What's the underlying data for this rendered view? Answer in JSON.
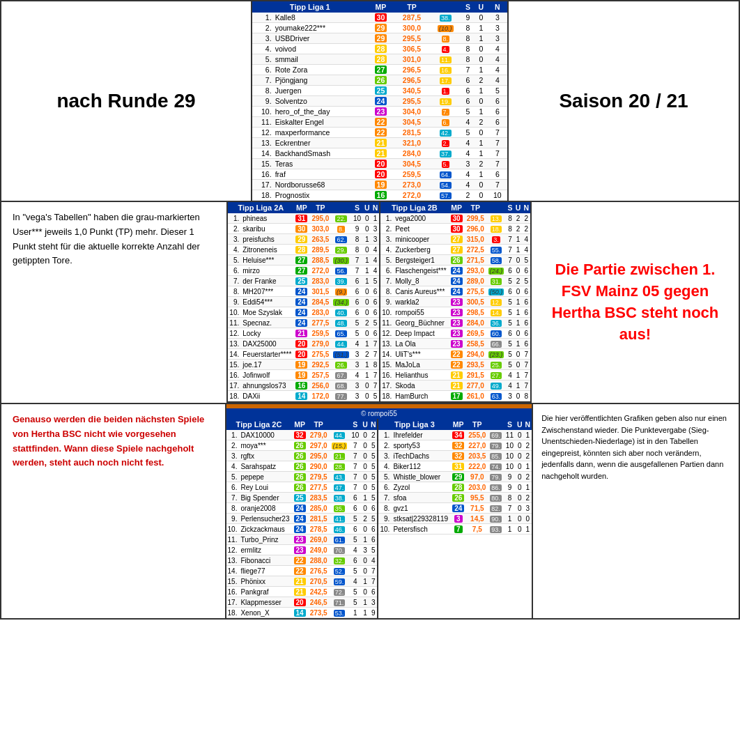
{
  "header": {
    "left_title": "nach Runde 29",
    "right_title": "Saison 20 / 21"
  },
  "mid_left_text": "In \"vega's Tabellen\" haben die grau-markierten User*** jeweils 1,0 Punkt (TP) mehr. Dieser 1 Punkt steht für die aktuelle korrekte Anzahl der getippten Tore.",
  "mid_right_text": "Die Partie zwischen 1. FSV Mainz 05 gegen Hertha BSC steht noch aus!",
  "bot_left_text": "Genauso werden die beiden nächsten Spiele von Hertha BSC nicht wie vorgesehen stattfinden. Wann diese Spiele nachgeholt werden, steht auch noch nicht fest.",
  "bot_right_text": "Die hier veröffentlichten Grafiken geben also nur einen Zwischenstand wieder. Die Punktevergabe (Sieg-Unentschieden-Niederlage) ist in den Tabellen eingepreist, könnten sich aber noch verändern, jedenfalls dann, wenn die ausgefallenen Partien dann nachgeholt wurden.",
  "rompoi_label": "© rompoi55",
  "liga1": {
    "title": "Tipp Liga 1",
    "cols": [
      "MP",
      "TP",
      "",
      "S",
      "U",
      "N"
    ],
    "rows": [
      {
        "rank": "1.",
        "name": "Kalle8",
        "mp": "30",
        "tp": "287,5",
        "badge": "38.",
        "s": "9",
        "u": "0",
        "n": "3",
        "mp_color": "red"
      },
      {
        "rank": "2.",
        "name": "youmake222***",
        "mp": "29",
        "tp": "300,0",
        "badge": "(10.)",
        "s": "8",
        "u": "1",
        "n": "3",
        "mp_color": "orange",
        "hl": "gray"
      },
      {
        "rank": "3.",
        "name": "USBDriver",
        "mp": "29",
        "tp": "295,5",
        "badge": "8.",
        "s": "8",
        "u": "1",
        "n": "3",
        "mp_color": "orange"
      },
      {
        "rank": "4.",
        "name": "voivod",
        "mp": "28",
        "tp": "306,5",
        "badge": "4.",
        "s": "8",
        "u": "0",
        "n": "4",
        "mp_color": "yellow"
      },
      {
        "rank": "5.",
        "name": "smmail",
        "mp": "28",
        "tp": "301,0",
        "badge": "11.",
        "s": "8",
        "u": "0",
        "n": "4",
        "mp_color": "yellow"
      },
      {
        "rank": "6.",
        "name": "Rote Zora",
        "mp": "27",
        "tp": "296,5",
        "badge": "16.",
        "s": "7",
        "u": "1",
        "n": "4",
        "mp_color": "green"
      },
      {
        "rank": "7.",
        "name": "Pjöngjang",
        "mp": "26",
        "tp": "296,5",
        "badge": "17.",
        "s": "6",
        "u": "2",
        "n": "4",
        "mp_color": "lime"
      },
      {
        "rank": "8.",
        "name": "Juergen",
        "mp": "25",
        "tp": "340,5",
        "badge": "1.",
        "s": "6",
        "u": "1",
        "n": "5",
        "mp_color": "cyan"
      },
      {
        "rank": "9.",
        "name": "Solventzo",
        "mp": "24",
        "tp": "295,5",
        "badge": "19.",
        "s": "6",
        "u": "0",
        "n": "6",
        "mp_color": "blue"
      },
      {
        "rank": "10.",
        "name": "hero_of_the_day",
        "mp": "23",
        "tp": "304,0",
        "badge": "7.",
        "s": "5",
        "u": "1",
        "n": "6",
        "mp_color": "magenta"
      },
      {
        "rank": "11.",
        "name": "Eiskalter Engel",
        "mp": "22",
        "tp": "304,5",
        "badge": "6.",
        "s": "4",
        "u": "2",
        "n": "6",
        "mp_color": "orange"
      },
      {
        "rank": "12.",
        "name": "maxperformance",
        "mp": "22",
        "tp": "281,5",
        "badge": "42.",
        "s": "5",
        "u": "0",
        "n": "7",
        "mp_color": "orange"
      },
      {
        "rank": "13.",
        "name": "Eckrentner",
        "mp": "21",
        "tp": "321,0",
        "badge": "2.",
        "s": "4",
        "u": "1",
        "n": "7",
        "mp_color": "yellow",
        "hl": "gray"
      },
      {
        "rank": "14.",
        "name": "BackhandSmash",
        "mp": "21",
        "tp": "284,0",
        "badge": "37.",
        "s": "4",
        "u": "1",
        "n": "7",
        "mp_color": "yellow"
      },
      {
        "rank": "15.",
        "name": "Teras",
        "mp": "20",
        "tp": "304,5",
        "badge": "5.",
        "s": "3",
        "u": "2",
        "n": "7",
        "mp_color": "red"
      },
      {
        "rank": "16.",
        "name": "fraf",
        "mp": "20",
        "tp": "259,5",
        "badge": "64.",
        "s": "4",
        "u": "1",
        "n": "6",
        "mp_color": "red"
      },
      {
        "rank": "17.",
        "name": "Nordborusse68",
        "mp": "19",
        "tp": "273,0",
        "badge": "54.",
        "s": "4",
        "u": "0",
        "n": "7",
        "mp_color": "orange"
      },
      {
        "rank": "18.",
        "name": "Prognostix",
        "mp": "16",
        "tp": "272,0",
        "badge": "57.",
        "s": "2",
        "u": "0",
        "n": "10",
        "mp_color": "green"
      }
    ]
  },
  "liga2a": {
    "title": "Tipp Liga 2A",
    "cols": [
      "MP",
      "TP",
      "",
      "S",
      "U",
      "N"
    ],
    "rows": [
      {
        "rank": "1.",
        "name": "phineas",
        "mp": "31",
        "tp": "295,0",
        "badge": "22.",
        "s": "10",
        "u": "0",
        "n": "1",
        "mp_color": "red"
      },
      {
        "rank": "2.",
        "name": "skaribu",
        "mp": "30",
        "tp": "303,0",
        "badge": "8.",
        "s": "9",
        "u": "0",
        "n": "3",
        "mp_color": "orange"
      },
      {
        "rank": "3.",
        "name": "preisfuchs",
        "mp": "29",
        "tp": "263,5",
        "badge": "62.",
        "s": "8",
        "u": "1",
        "n": "3",
        "mp_color": "yellow"
      },
      {
        "rank": "4.",
        "name": "Zitroneneis",
        "mp": "28",
        "tp": "289,5",
        "badge": "29.",
        "s": "8",
        "u": "0",
        "n": "4",
        "mp_color": "yellow"
      },
      {
        "rank": "5.",
        "name": "Heluise***",
        "mp": "27",
        "tp": "288,5",
        "badge": "(30.)",
        "s": "7",
        "u": "1",
        "n": "4",
        "mp_color": "green",
        "hl": "gray"
      },
      {
        "rank": "6.",
        "name": "mirzo",
        "mp": "27",
        "tp": "272,0",
        "badge": "56.",
        "s": "7",
        "u": "1",
        "n": "4",
        "mp_color": "green"
      },
      {
        "rank": "7.",
        "name": "der Franke",
        "mp": "25",
        "tp": "283,0",
        "badge": "39.",
        "s": "6",
        "u": "1",
        "n": "5",
        "mp_color": "cyan"
      },
      {
        "rank": "8.",
        "name": "MH207***",
        "mp": "24",
        "tp": "301,5",
        "badge": "(9.)",
        "s": "6",
        "u": "0",
        "n": "6",
        "mp_color": "blue",
        "hl": "gray"
      },
      {
        "rank": "9.",
        "name": "Eddi54***",
        "mp": "24",
        "tp": "284,5",
        "badge": "(34.)",
        "s": "6",
        "u": "0",
        "n": "6",
        "mp_color": "blue",
        "hl": "gray"
      },
      {
        "rank": "10.",
        "name": "Moe Szyslak",
        "mp": "24",
        "tp": "283,0",
        "badge": "40.",
        "s": "6",
        "u": "0",
        "n": "6",
        "mp_color": "blue"
      },
      {
        "rank": "11.",
        "name": "Specnaz.",
        "mp": "24",
        "tp": "277,5",
        "badge": "48.",
        "s": "5",
        "u": "2",
        "n": "5",
        "mp_color": "blue"
      },
      {
        "rank": "12.",
        "name": "Locky",
        "mp": "21",
        "tp": "259,5",
        "badge": "65.",
        "s": "5",
        "u": "0",
        "n": "6",
        "mp_color": "magenta"
      },
      {
        "rank": "13.",
        "name": "DAX25000",
        "mp": "20",
        "tp": "279,0",
        "badge": "44.",
        "s": "4",
        "u": "1",
        "n": "7",
        "mp_color": "red"
      },
      {
        "rank": "14.",
        "name": "Feuerstarter****",
        "mp": "20",
        "tp": "275,5",
        "badge": "(51.)",
        "s": "3",
        "u": "2",
        "n": "7",
        "mp_color": "red",
        "hl": "gray"
      },
      {
        "rank": "15.",
        "name": "joe.17",
        "mp": "19",
        "tp": "292,5",
        "badge": "26.",
        "s": "3",
        "u": "1",
        "n": "8",
        "mp_color": "orange"
      },
      {
        "rank": "16.",
        "name": "Jofinwolf",
        "mp": "19",
        "tp": "257,5",
        "badge": "67.",
        "s": "4",
        "u": "1",
        "n": "7",
        "mp_color": "orange"
      },
      {
        "rank": "17.",
        "name": "ahnungslos73",
        "mp": "16",
        "tp": "256,0",
        "badge": "68.",
        "s": "3",
        "u": "0",
        "n": "7",
        "mp_color": "green"
      },
      {
        "rank": "18.",
        "name": "DAXii",
        "mp": "14",
        "tp": "172,0",
        "badge": "77.",
        "s": "3",
        "u": "0",
        "n": "5",
        "mp_color": "cyan"
      }
    ]
  },
  "liga2b": {
    "title": "Tipp Liga 2B",
    "cols": [
      "MP",
      "TP",
      "",
      "S",
      "U",
      "N"
    ],
    "rows": [
      {
        "rank": "1.",
        "name": "vega2000",
        "mp": "30",
        "tp": "299,5",
        "badge": "13.",
        "s": "8",
        "u": "2",
        "n": "2",
        "mp_color": "red"
      },
      {
        "rank": "2.",
        "name": "Peet",
        "mp": "30",
        "tp": "296,0",
        "badge": "18.",
        "s": "8",
        "u": "2",
        "n": "2",
        "mp_color": "red"
      },
      {
        "rank": "3.",
        "name": "minicooper",
        "mp": "27",
        "tp": "315,0",
        "badge": "3.",
        "s": "7",
        "u": "1",
        "n": "4",
        "mp_color": "yellow"
      },
      {
        "rank": "4.",
        "name": "Zuckerberg",
        "mp": "27",
        "tp": "272,5",
        "badge": "55.",
        "s": "7",
        "u": "1",
        "n": "4",
        "mp_color": "yellow"
      },
      {
        "rank": "5.",
        "name": "Bergsteiger1",
        "mp": "26",
        "tp": "271,5",
        "badge": "58.",
        "s": "7",
        "u": "0",
        "n": "5",
        "mp_color": "lime"
      },
      {
        "rank": "6.",
        "name": "Flaschengeist***",
        "mp": "24",
        "tp": "293,0",
        "badge": "(24.)",
        "s": "6",
        "u": "0",
        "n": "6",
        "mp_color": "blue",
        "hl": "gray"
      },
      {
        "rank": "7.",
        "name": "Molly_8",
        "mp": "24",
        "tp": "289,0",
        "badge": "31.",
        "s": "5",
        "u": "2",
        "n": "5",
        "mp_color": "blue"
      },
      {
        "rank": "8.",
        "name": "Canis Aureus***",
        "mp": "24",
        "tp": "275,5",
        "badge": "(50.)",
        "s": "6",
        "u": "0",
        "n": "6",
        "mp_color": "blue",
        "hl": "gray"
      },
      {
        "rank": "9.",
        "name": "warkla2",
        "mp": "23",
        "tp": "300,5",
        "badge": "12.",
        "s": "5",
        "u": "1",
        "n": "6",
        "mp_color": "magenta"
      },
      {
        "rank": "10.",
        "name": "rompoi55",
        "mp": "23",
        "tp": "298,5",
        "badge": "14.",
        "s": "5",
        "u": "1",
        "n": "6",
        "mp_color": "magenta"
      },
      {
        "rank": "11.",
        "name": "Georg_Büchner",
        "mp": "23",
        "tp": "284,0",
        "badge": "36.",
        "s": "5",
        "u": "1",
        "n": "6",
        "mp_color": "magenta"
      },
      {
        "rank": "12.",
        "name": "Deep Impact",
        "mp": "23",
        "tp": "269,5",
        "badge": "60.",
        "s": "6",
        "u": "0",
        "n": "6",
        "mp_color": "magenta"
      },
      {
        "rank": "13.",
        "name": "La Ola",
        "mp": "23",
        "tp": "258,5",
        "badge": "66.",
        "s": "5",
        "u": "1",
        "n": "6",
        "mp_color": "magenta"
      },
      {
        "rank": "14.",
        "name": "UliT's***",
        "mp": "22",
        "tp": "294,0",
        "badge": "(23.)",
        "s": "5",
        "u": "0",
        "n": "7",
        "mp_color": "orange",
        "hl": "gray"
      },
      {
        "rank": "15.",
        "name": "MaJoLa",
        "mp": "22",
        "tp": "293,5",
        "badge": "25.",
        "s": "5",
        "u": "0",
        "n": "7",
        "mp_color": "orange"
      },
      {
        "rank": "16.",
        "name": "Helianthus",
        "mp": "21",
        "tp": "291,5",
        "badge": "27.",
        "s": "4",
        "u": "1",
        "n": "7",
        "mp_color": "yellow"
      },
      {
        "rank": "17.",
        "name": "Skoda",
        "mp": "21",
        "tp": "277,0",
        "badge": "49.",
        "s": "4",
        "u": "1",
        "n": "7",
        "mp_color": "yellow"
      },
      {
        "rank": "18.",
        "name": "HamBurch",
        "mp": "17",
        "tp": "261,0",
        "badge": "63.",
        "s": "3",
        "u": "0",
        "n": "8",
        "mp_color": "green"
      }
    ]
  },
  "liga2c": {
    "title": "Tipp Liga 2C",
    "cols": [
      "MP",
      "TP",
      "",
      "S",
      "U",
      "N"
    ],
    "rows": [
      {
        "rank": "1.",
        "name": "DAX10000",
        "mp": "32",
        "tp": "279,0",
        "badge": "44.",
        "s": "10",
        "u": "0",
        "n": "2",
        "mp_color": "red"
      },
      {
        "rank": "2.",
        "name": "moya***",
        "mp": "26",
        "tp": "297,0",
        "badge": "(15.)",
        "s": "7",
        "u": "0",
        "n": "5",
        "mp_color": "lime",
        "hl": "gray"
      },
      {
        "rank": "3.",
        "name": "rgftx",
        "mp": "26",
        "tp": "295,0",
        "badge": "21.",
        "s": "7",
        "u": "0",
        "n": "5",
        "mp_color": "lime"
      },
      {
        "rank": "4.",
        "name": "Sarahspatz",
        "mp": "26",
        "tp": "290,0",
        "badge": "28.",
        "s": "7",
        "u": "0",
        "n": "5",
        "mp_color": "lime"
      },
      {
        "rank": "5.",
        "name": "pepepe",
        "mp": "26",
        "tp": "279,5",
        "badge": "43.",
        "s": "7",
        "u": "0",
        "n": "5",
        "mp_color": "lime"
      },
      {
        "rank": "6.",
        "name": "Rey Loui",
        "mp": "26",
        "tp": "277,5",
        "badge": "47.",
        "s": "7",
        "u": "0",
        "n": "5",
        "mp_color": "lime"
      },
      {
        "rank": "7.",
        "name": "Big Spender",
        "mp": "25",
        "tp": "283,5",
        "badge": "38.",
        "s": "6",
        "u": "1",
        "n": "5",
        "mp_color": "cyan"
      },
      {
        "rank": "8.",
        "name": "oranje2008",
        "mp": "24",
        "tp": "285,0",
        "badge": "35.",
        "s": "6",
        "u": "0",
        "n": "6",
        "mp_color": "blue"
      },
      {
        "rank": "9.",
        "name": "Perlensucher23",
        "mp": "24",
        "tp": "281,5",
        "badge": "41.",
        "s": "5",
        "u": "2",
        "n": "5",
        "mp_color": "blue"
      },
      {
        "rank": "10.",
        "name": "Zickzackmaus",
        "mp": "24",
        "tp": "278,5",
        "badge": "46.",
        "s": "6",
        "u": "0",
        "n": "6",
        "mp_color": "blue"
      },
      {
        "rank": "11.",
        "name": "Turbo_Prinz",
        "mp": "23",
        "tp": "269,0",
        "badge": "61.",
        "s": "5",
        "u": "1",
        "n": "6",
        "mp_color": "magenta"
      },
      {
        "rank": "12.",
        "name": "ermlitz",
        "mp": "23",
        "tp": "249,0",
        "badge": "70.",
        "s": "4",
        "u": "3",
        "n": "5",
        "mp_color": "magenta"
      },
      {
        "rank": "13.",
        "name": "Fibonacci",
        "mp": "22",
        "tp": "288,0",
        "badge": "32.",
        "s": "6",
        "u": "0",
        "n": "4",
        "mp_color": "orange"
      },
      {
        "rank": "14.",
        "name": "fliege77",
        "mp": "22",
        "tp": "276,5",
        "badge": "52.",
        "s": "5",
        "u": "0",
        "n": "7",
        "mp_color": "orange"
      },
      {
        "rank": "15.",
        "name": "Phönixx",
        "mp": "21",
        "tp": "270,5",
        "badge": "59.",
        "s": "4",
        "u": "1",
        "n": "7",
        "mp_color": "yellow"
      },
      {
        "rank": "16.",
        "name": "Pankgraf",
        "mp": "21",
        "tp": "242,5",
        "badge": "72.",
        "s": "5",
        "u": "0",
        "n": "6",
        "mp_color": "yellow"
      },
      {
        "rank": "17.",
        "name": "Klappmesser",
        "mp": "20",
        "tp": "246,5",
        "badge": "71.",
        "s": "5",
        "u": "1",
        "n": "3",
        "mp_color": "red"
      },
      {
        "rank": "18.",
        "name": "Xenon_X",
        "mp": "14",
        "tp": "273,5",
        "badge": "53.",
        "s": "1",
        "u": "1",
        "n": "9",
        "mp_color": "cyan"
      }
    ]
  },
  "liga3": {
    "title": "Tipp Liga 3",
    "cols": [
      "MP",
      "TP",
      "",
      "S",
      "U",
      "N"
    ],
    "rows": [
      {
        "rank": "1.",
        "name": "Ihrefelder",
        "mp": "34",
        "tp": "255,0",
        "badge": "69.",
        "s": "11",
        "u": "0",
        "n": "1",
        "mp_color": "red"
      },
      {
        "rank": "2.",
        "name": "sporty53",
        "mp": "32",
        "tp": "227,0",
        "badge": "79.",
        "s": "10",
        "u": "0",
        "n": "2",
        "mp_color": "orange"
      },
      {
        "rank": "3.",
        "name": "iTechDachs",
        "mp": "32",
        "tp": "203,5",
        "badge": "85.",
        "s": "10",
        "u": "0",
        "n": "2",
        "mp_color": "orange"
      },
      {
        "rank": "4.",
        "name": "Biker112",
        "mp": "31",
        "tp": "222,0",
        "badge": "74.",
        "s": "10",
        "u": "0",
        "n": "1",
        "mp_color": "yellow"
      },
      {
        "rank": "5.",
        "name": "Whistle_blower",
        "mp": "29",
        "tp": "97,0",
        "badge": "79.",
        "s": "9",
        "u": "0",
        "n": "2",
        "mp_color": "green"
      },
      {
        "rank": "6.",
        "name": "Zyzol",
        "mp": "28",
        "tp": "203,0",
        "badge": "86.",
        "s": "9",
        "u": "0",
        "n": "1",
        "mp_color": "lime"
      },
      {
        "rank": "7.",
        "name": "sfoa",
        "mp": "26",
        "tp": "95,5",
        "badge": "80.",
        "s": "8",
        "u": "0",
        "n": "2",
        "mp_color": "lime"
      },
      {
        "rank": "8.",
        "name": "gvz1",
        "mp": "24",
        "tp": "71,5",
        "badge": "82.",
        "s": "7",
        "u": "0",
        "n": "3",
        "mp_color": "blue"
      },
      {
        "rank": "9.",
        "name": "stksat|229328119",
        "mp": "3",
        "tp": "14,5",
        "badge": "90.",
        "s": "1",
        "u": "0",
        "n": "0",
        "mp_color": "magenta"
      },
      {
        "rank": "10.",
        "name": "Petersfisch",
        "mp": "7",
        "tp": "7,5",
        "badge": "93.",
        "s": "1",
        "u": "0",
        "n": "1",
        "mp_color": "green"
      }
    ]
  },
  "mp_colors": {
    "red": "#ff0000",
    "orange": "#ff8800",
    "yellow": "#ffcc00",
    "green": "#00aa00",
    "lime": "#66cc00",
    "cyan": "#00aacc",
    "blue": "#0055cc",
    "magenta": "#cc00cc"
  }
}
